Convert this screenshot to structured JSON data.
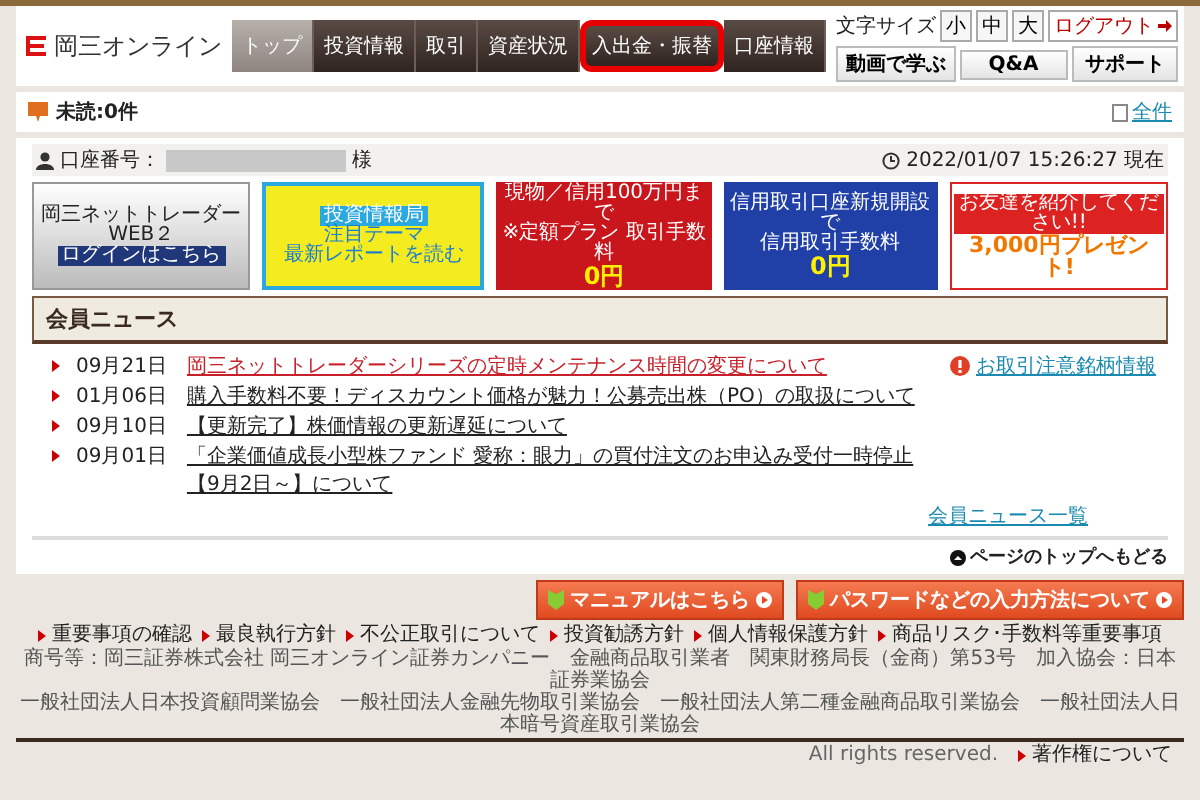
{
  "header": {
    "logo": "岡三オンライン",
    "nav": [
      {
        "label": "トップ",
        "selected": true,
        "highlighted": false
      },
      {
        "label": "投資情報",
        "selected": false,
        "highlighted": false
      },
      {
        "label": "取引",
        "selected": false,
        "highlighted": false
      },
      {
        "label": "資産状況",
        "selected": false,
        "highlighted": false
      },
      {
        "label": "入出金・振替",
        "selected": false,
        "highlighted": true
      },
      {
        "label": "口座情報",
        "selected": false,
        "highlighted": false
      }
    ],
    "font_size_label": "文字サイズ",
    "font_sizes": [
      "小",
      "中",
      "大"
    ],
    "logout": "ログアウト",
    "links": [
      "動画で学ぶ",
      "Q&A",
      "サポート"
    ]
  },
  "unread": {
    "label": "未読:0件",
    "all_link": "全件"
  },
  "account": {
    "label": "口座番号：",
    "suffix": "様",
    "timestamp": "2022/01/07 15:26:27 現在"
  },
  "banners": [
    {
      "kind": "trader",
      "lines": [
        "岡三ネットトレーダーWEB２",
        "ログインはこちら"
      ]
    },
    {
      "kind": "report",
      "lines": [
        "投資情報局",
        "注目テーマ",
        "最新レポートを読む"
      ]
    },
    {
      "kind": "fee",
      "lines": [
        "現物／信用100万円まで",
        "※定額プラン 取引手数料",
        "0円"
      ]
    },
    {
      "kind": "margin",
      "lines": [
        "信用取引口座新規開設で",
        "信用取引手数料",
        "0円"
      ]
    },
    {
      "kind": "gift",
      "lines": [
        "お友達を紹介してください!!",
        "3,000円プレゼント!"
      ]
    }
  ],
  "news": {
    "title": "会員ニュース",
    "notice_link": "お取引注意銘柄情報",
    "items": [
      {
        "date": "09月21日",
        "title": "岡三ネットトレーダーシリーズの定時メンテナンス時間の変更について",
        "highlighted": true
      },
      {
        "date": "01月06日",
        "title": "購入手数料不要！ディスカウント価格が魅力！公募売出株（PO）の取扱について",
        "highlighted": false
      },
      {
        "date": "09月10日",
        "title": "【更新完了】株価情報の更新遅延について",
        "highlighted": false
      },
      {
        "date": "09月01日",
        "title": "「企業価値成長小型株ファンド 愛称：眼力」の買付注文のお申込み受付一時停止【9月2日～】について",
        "highlighted": false
      }
    ],
    "list_link": "会員ニュース一覧",
    "page_top": "ページのトップへもどる"
  },
  "footer": {
    "buttons": [
      "マニュアルはこちら",
      "パスワードなどの入力方法について"
    ],
    "links": [
      "重要事項の確認",
      "最良執行方針",
      "不公正取引について",
      "投資勧誘方針",
      "個人情報保護方針",
      "商品リスク･手数料等重要事項"
    ],
    "disclosure": [
      "商号等：岡三証券株式会社 岡三オンライン証券カンパニー　金融商品取引業者　関東財務局長（金商）第53号　加入協会：日本証券業協会",
      "一般社団法人日本投資顧問業協会　一般社団法人金融先物取引業協会　一般社団法人第二種金融商品取引業協会　一般社団法人日本暗号資産取引業協会"
    ],
    "rights": "All rights reserved.",
    "copyright_link": "著作権について"
  }
}
